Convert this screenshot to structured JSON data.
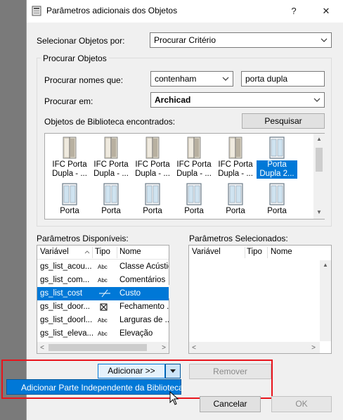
{
  "dialog": {
    "title": "Parâmetros adicionais dos Objetos",
    "help_label": "?",
    "close_label": "✕"
  },
  "select_by": {
    "label": "Selecionar Objetos por:",
    "value": "Procurar Critério"
  },
  "search": {
    "group_title": "Procurar Objetos",
    "names_label": "Procurar nomes que:",
    "condition_value": "contenham",
    "text_value": "porta dupla",
    "in_label": "Procurar em:",
    "in_value": "Archicad",
    "found_label": "Objetos de Biblioteca encontrados:",
    "search_button": "Pesquisar"
  },
  "library_items": [
    {
      "line1": "IFC Porta",
      "line2": "Dupla - ...",
      "selected": false,
      "icon": "door-double-icon"
    },
    {
      "line1": "IFC Porta",
      "line2": "Dupla - ...",
      "selected": false,
      "icon": "door-double-icon"
    },
    {
      "line1": "IFC Porta",
      "line2": "Dupla - ...",
      "selected": false,
      "icon": "door-double-icon"
    },
    {
      "line1": "IFC Porta",
      "line2": "Dupla - ...",
      "selected": false,
      "icon": "door-double-icon"
    },
    {
      "line1": "IFC Porta",
      "line2": "Dupla - ...",
      "selected": false,
      "icon": "door-double-icon"
    },
    {
      "line1": "Porta",
      "line2": "Dupla 2...",
      "selected": true,
      "icon": "door-glass-icon"
    },
    {
      "line1": "Porta",
      "line2": "",
      "selected": false,
      "icon": "door-glass-icon"
    },
    {
      "line1": "Porta",
      "line2": "",
      "selected": false,
      "icon": "door-glass-icon"
    },
    {
      "line1": "Porta",
      "line2": "",
      "selected": false,
      "icon": "door-glass-icon"
    },
    {
      "line1": "Porta",
      "line2": "",
      "selected": false,
      "icon": "door-glass-icon"
    },
    {
      "line1": "Porta",
      "line2": "",
      "selected": false,
      "icon": "door-glass-icon"
    },
    {
      "line1": "Porta",
      "line2": "",
      "selected": false,
      "icon": "door-glass-icon"
    }
  ],
  "available": {
    "label": "Parâmetros Disponíveis:",
    "columns": [
      "Variável",
      "Tipo",
      "Nome"
    ],
    "rows": [
      {
        "var": "gs_list_acou...",
        "type": "Abc",
        "name": "Classe Acústic",
        "selected": false
      },
      {
        "var": "gs_list_com...",
        "type": "Abc",
        "name": "Comentários",
        "selected": false
      },
      {
        "var": "gs_list_cost",
        "type": "cost",
        "name": "Custo",
        "selected": true
      },
      {
        "var": "gs_list_door...",
        "type": "box",
        "name": "Fechamento ...",
        "selected": false
      },
      {
        "var": "gs_list_doorl...",
        "type": "Abc",
        "name": "Larguras de ...",
        "selected": false
      },
      {
        "var": "gs_list_eleva...",
        "type": "Abc",
        "name": "Elevação",
        "selected": false
      }
    ]
  },
  "selected_params": {
    "label": "Parâmetros Selecionados:",
    "columns": [
      "Variável",
      "Tipo",
      "Nome"
    ]
  },
  "buttons": {
    "add": "Adicionar >>",
    "remove": "Remover",
    "cancel": "Cancelar",
    "ok": "OK"
  },
  "dropdown_menu": {
    "item": "Adicionar Parte Independente da Biblioteca"
  },
  "colors": {
    "selection": "#0078d7",
    "highlight_border": "#e8141c"
  }
}
